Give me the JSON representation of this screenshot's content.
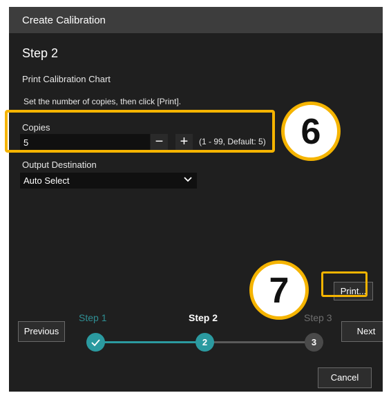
{
  "dialog": {
    "title": "Create Calibration",
    "step_heading": "Step 2",
    "subtitle": "Print Calibration Chart",
    "instructions": "Set the number of copies, then click [Print]."
  },
  "copies": {
    "label": "Copies",
    "value": "5",
    "decrement_symbol": "−",
    "increment_symbol": "+",
    "range_hint": "(1 - 99, Default: 5)"
  },
  "output": {
    "label": "Output Destination",
    "selected": "Auto Select"
  },
  "buttons": {
    "print": "Print...",
    "previous": "Previous",
    "next": "Next",
    "cancel": "Cancel"
  },
  "stepper": {
    "steps": [
      {
        "label": "Step 1",
        "number": "",
        "state": "complete"
      },
      {
        "label": "Step 2",
        "number": "2",
        "state": "current"
      },
      {
        "label": "Step 3",
        "number": "3",
        "state": "upcoming"
      }
    ]
  },
  "annotations": {
    "badge_copies": "6",
    "badge_print": "7"
  },
  "colors": {
    "accent": "#2b9aa0",
    "highlight": "#f5b400",
    "dialog_bg": "#1f1f1f",
    "titlebar_bg": "#3d3d3d"
  }
}
